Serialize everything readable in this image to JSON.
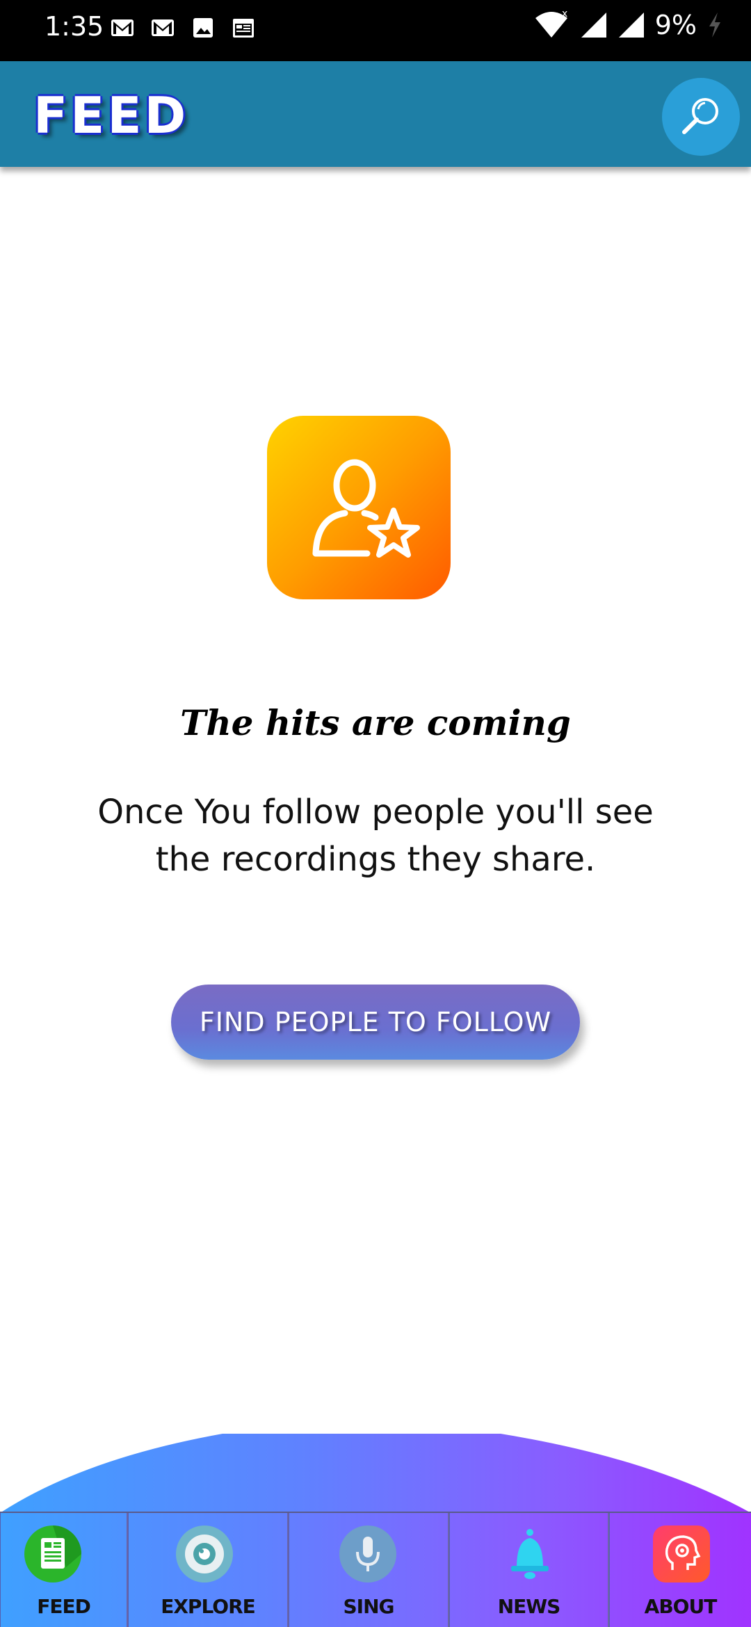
{
  "status_bar": {
    "time": "1:35",
    "battery": "9%",
    "icons_left": [
      "gmail-icon",
      "gmail-icon",
      "image-icon",
      "calendar-icon"
    ],
    "icons_right": [
      "wifi-icon",
      "signal-icon",
      "signal-icon",
      "charging-icon"
    ]
  },
  "app_bar": {
    "title": "FEED",
    "search_icon": "magnifier-icon",
    "color": "#1e7fa6"
  },
  "empty_state": {
    "icon": "user-star-icon",
    "headline": "The hits are coming",
    "message": "Once You follow people you'll see the recordings they share.",
    "button_label": "FIND PEOPLE TO FOLLOW"
  },
  "bottom_nav": {
    "items": [
      {
        "label": "FEED",
        "icon": "feed-icon",
        "active": true
      },
      {
        "label": "EXPLORE",
        "icon": "eye-icon"
      },
      {
        "label": "SING",
        "icon": "microphone-icon"
      },
      {
        "label": "NEWS",
        "icon": "bell-icon"
      },
      {
        "label": "ABOUT",
        "icon": "brain-gear-icon"
      }
    ]
  }
}
